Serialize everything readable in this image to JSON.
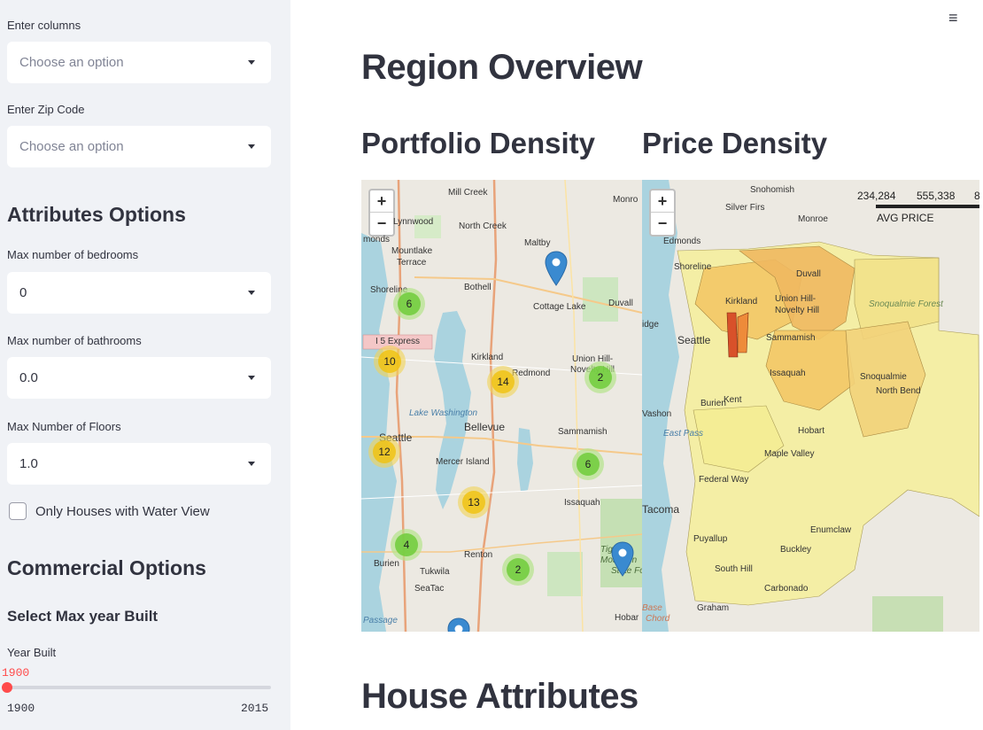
{
  "sidebar": {
    "columns_label": "Enter columns",
    "columns_placeholder": "Choose an option",
    "zip_label": "Enter Zip Code",
    "zip_placeholder": "Choose an option",
    "attributes_heading": "Attributes Options",
    "bedrooms_label": "Max number of bedrooms",
    "bedrooms_value": "0",
    "bathrooms_label": "Max number of bathrooms",
    "bathrooms_value": "0.0",
    "floors_label": "Max Number of Floors",
    "floors_value": "1.0",
    "waterview_label": "Only Houses with Water View",
    "commercial_heading": "Commercial Options",
    "year_heading": "Select Max year Built",
    "year_label": "Year Built",
    "year_value": "1900",
    "year_min": "1900",
    "year_max": "2015",
    "year_fraction": 0.0
  },
  "main": {
    "menu_icon": "≡",
    "title": "Region Overview",
    "portfolio_title": "Portfolio Density",
    "price_title": "Price Density",
    "section2_title": "House Attributes"
  },
  "portfolio_map": {
    "zoom_in": "+",
    "zoom_out": "−",
    "clusters": [
      {
        "count": "6",
        "color": "green"
      },
      {
        "count": "10",
        "color": "yellow"
      },
      {
        "count": "14",
        "color": "yellow"
      },
      {
        "count": "2",
        "color": "green"
      },
      {
        "count": "12",
        "color": "yellow"
      },
      {
        "count": "6",
        "color": "green"
      },
      {
        "count": "13",
        "color": "yellow"
      },
      {
        "count": "4",
        "color": "green"
      },
      {
        "count": "2",
        "color": "green"
      }
    ],
    "places": {
      "mill_creek": "Mill Creek",
      "lynnwood": "Lynnwood",
      "north_creek": "North Creek",
      "maltby": "Maltby",
      "mountlake": "Mountlake",
      "terrace": "Terrace",
      "bothell": "Bothell",
      "cottage_lake": "Cottage Lake",
      "duvall": "Duvall",
      "shoreline": "Shoreline",
      "i5": "I 5 Express",
      "kirkland": "Kirkland",
      "redmond": "Redmond",
      "union_hill": "Union Hill-",
      "novelty_hill": "Novelty Hill",
      "lake_washington": "Lake Washington",
      "seattle": "Seattle",
      "bellevue": "Bellevue",
      "sammamish": "Sammamish",
      "mercer_island": "Mercer Island",
      "issaquah": "Issaquah",
      "renton": "Renton",
      "burien": "Burien",
      "tukwila": "Tukwila",
      "seatac": "SeaTac",
      "monro": "Monro",
      "monds": "monds",
      "tiger": "Tiger",
      "mountain": "Mountain",
      "state_forest": "State Fo",
      "hobar": "Hobar",
      "passage": "Passage"
    }
  },
  "price_map": {
    "zoom_in": "+",
    "zoom_out": "−",
    "legend_title": "AVG PRICE",
    "legend_ticks": [
      "234,284",
      "555,338",
      "8"
    ],
    "places": {
      "snohomish": "Snohomish",
      "silver_firs": "Silver Firs",
      "monroe": "Monroe",
      "edmonds": "Edmonds",
      "shoreline": "Shoreline",
      "duvall": "Duvall",
      "kirkland": "Kirkland",
      "union_hill": "Union Hill-",
      "novelty_hill": "Novelty Hill",
      "seattle": "Seattle",
      "sammamish": "Sammamish",
      "snoqualmie_forest": "Snoqualmie Forest",
      "issaquah": "Issaquah",
      "snoqualmie": "Snoqualmie",
      "north_bend": "North Bend",
      "burien": "Burien",
      "kent": "Kent",
      "vashon": "Vashon",
      "hobart": "Hobart",
      "east_pass": "East Pass",
      "maple_valley": "Maple Valley",
      "federal_way": "Federal Way",
      "tacoma": "Tacoma",
      "enumclaw": "Enumclaw",
      "puyallup": "Puyallup",
      "buckley": "Buckley",
      "south_hill": "South Hill",
      "carbonado": "Carbonado",
      "graham": "Graham",
      "base": "Base",
      "ichord": "Chord",
      "idge": "idge"
    }
  }
}
